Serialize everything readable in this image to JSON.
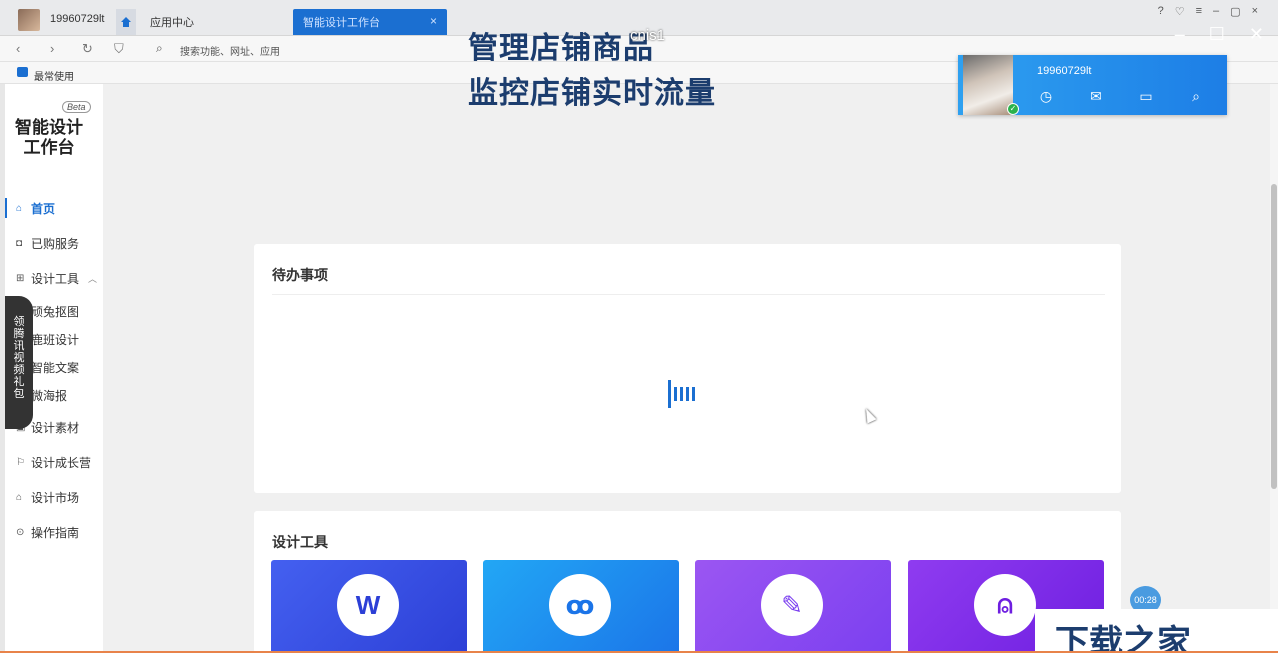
{
  "browser": {
    "username": "19960729lt",
    "tabs": [
      {
        "label": "应用中心"
      },
      {
        "label": "智能设计工作台",
        "close": "×"
      }
    ],
    "address_placeholder": "搜索功能、网址、应用",
    "bookmark": "最常使用"
  },
  "overlay": {
    "headline_1": "管理店铺商品",
    "headline_2": "监控店铺实时流量",
    "camera_label": "cnis1"
  },
  "profile": {
    "name": "19960729lt"
  },
  "sidebar": {
    "beta": "Beta",
    "logo_line1": "智能设计",
    "logo_line2": "工作台",
    "items": [
      {
        "label": "首页",
        "icon": "home-icon"
      },
      {
        "label": "已购服务",
        "icon": "bag-icon"
      },
      {
        "label": "设计工具",
        "icon": "grid-icon"
      },
      {
        "label": "设计素材",
        "icon": "image-icon"
      },
      {
        "label": "设计成长营",
        "icon": "flag-icon"
      },
      {
        "label": "设计市场",
        "icon": "shop-icon"
      },
      {
        "label": "操作指南",
        "icon": "help-icon"
      }
    ],
    "sub_items": [
      "顽兔抠图",
      "鹿班设计",
      "智能文案",
      "微海报"
    ]
  },
  "gift_tab": [
    "领",
    "腾",
    "讯",
    "视",
    "频",
    "礼",
    "包"
  ],
  "main": {
    "todo_title": "待办事项",
    "tools_title": "设计工具"
  },
  "timer": "00:28",
  "watermark": "下载之家",
  "colors": {
    "accent": "#1b6fd1",
    "tile1": "#3b4fe0",
    "tile2": "#1f8ef0",
    "tile3": "#8b4ef0",
    "tile4": "#8a2ee8"
  }
}
